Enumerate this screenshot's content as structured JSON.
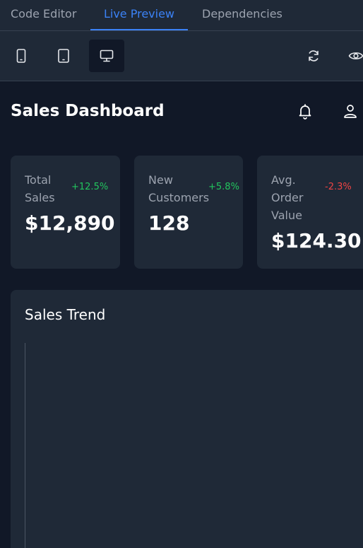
{
  "tabs": {
    "code_editor": "Code Editor",
    "live_preview": "Live Preview",
    "dependencies": "Dependencies",
    "active": "Live Preview"
  },
  "toolbar": {
    "devices": [
      "mobile-icon",
      "tablet-icon",
      "desktop-icon"
    ],
    "active_device": "desktop-icon",
    "actions": [
      "refresh-icon",
      "eye-icon"
    ]
  },
  "dashboard": {
    "title": "Sales Dashboard",
    "header_icons": [
      "bell-icon",
      "user-icon"
    ],
    "cards": [
      {
        "label": "Total Sales",
        "change": "+12.5%",
        "value": "$12,890",
        "trend": "up"
      },
      {
        "label": "New Customers",
        "change": "+5.8%",
        "value": "128",
        "trend": "up"
      },
      {
        "label": "Avg. Order Value",
        "change": "-2.3%",
        "value": "$124.30",
        "trend": "down"
      }
    ],
    "trend_title": "Sales Trend"
  },
  "colors": {
    "accent": "#3b82f6",
    "positive": "#22c55e",
    "negative": "#ef4444",
    "background": "#111827",
    "panel": "#1f2937"
  }
}
